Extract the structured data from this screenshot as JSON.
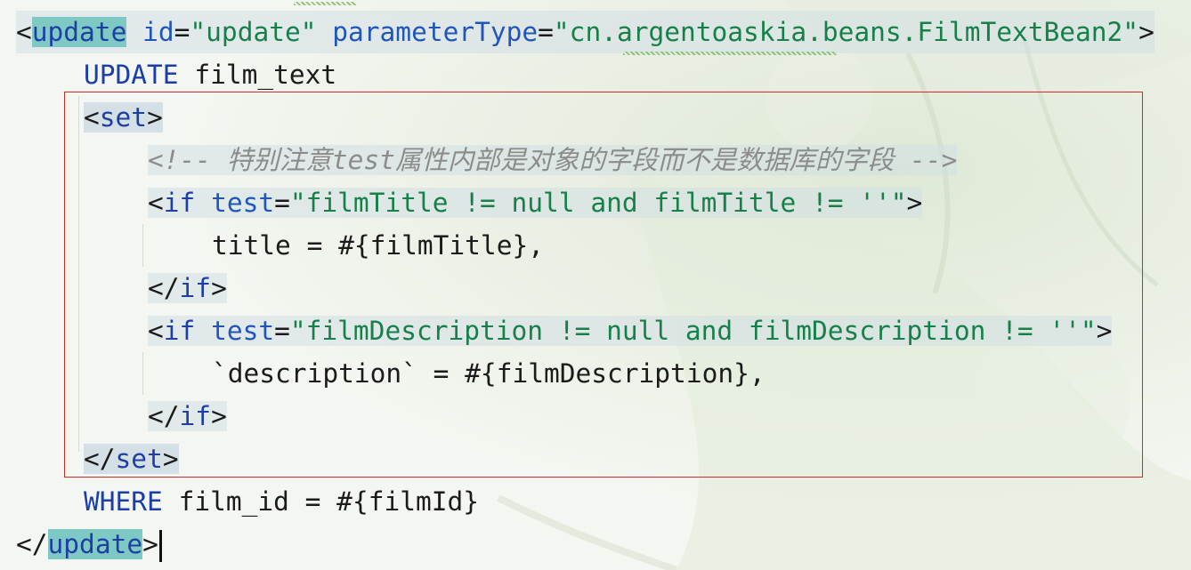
{
  "editor": {
    "open_tag": {
      "lt": "<",
      "name": "update",
      "attr1": "id",
      "eq1": "=",
      "val1": "\"update\"",
      "attr2": "parameterType",
      "eq2": "=",
      "val2": "\"cn.argentoaskia.beans.FilmTextBean2\"",
      "gt": ">"
    },
    "update_line": {
      "kw": "UPDATE",
      "table": "film_text"
    },
    "set_open": {
      "lt": "<",
      "name": "set",
      "gt": ">"
    },
    "comment": "<!-- 特别注意test属性内部是对象的字段而不是数据库的字段 -->",
    "if1_open": {
      "lt": "<",
      "name": "if",
      "attr": "test",
      "eq": "=",
      "val": "\"filmTitle != null and filmTitle != ''\"",
      "gt": ">"
    },
    "if1_body": "title = #{filmTitle},",
    "if1_close": {
      "lt": "</",
      "name": "if",
      "gt": ">"
    },
    "if2_open": {
      "lt": "<",
      "name": "if",
      "attr": "test",
      "eq": "=",
      "val": "\"filmDescription != null and filmDescription != ''\"",
      "gt": ">"
    },
    "if2_body": "`description` = #{filmDescription},",
    "if2_close": {
      "lt": "</",
      "name": "if",
      "gt": ">"
    },
    "set_close": {
      "lt": "</",
      "name": "set",
      "gt": ">"
    },
    "where_line": {
      "kw": "WHERE",
      "rest": "film_id = #{filmId}"
    },
    "close_tag": {
      "lt": "</",
      "name": "update",
      "gt": ">"
    }
  },
  "colors": {
    "tag_name": "#1d3fa3",
    "attribute": "#1f56b8",
    "string_value": "#17804a",
    "comment": "#8c8c8c",
    "selection_box": "#d12b2b",
    "tag_highlight": "#7ec9c3"
  }
}
